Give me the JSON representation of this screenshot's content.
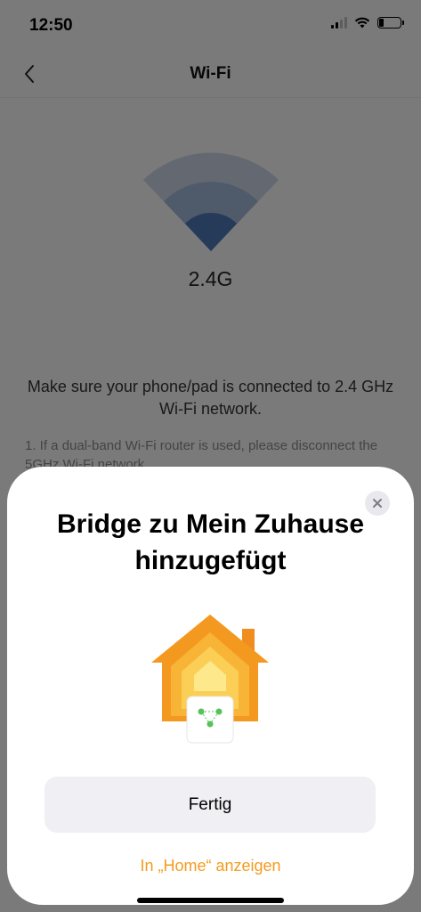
{
  "status_bar": {
    "time": "12:50",
    "battery_level": 0.2
  },
  "nav": {
    "title": "Wi-Fi",
    "back_icon": "chevron-left-icon"
  },
  "wifi": {
    "band": "2.4G",
    "instruction": "Make sure your phone/pad is connected to 2.4 GHz Wi-Fi network.",
    "hint": "1. If a dual-band Wi-Fi router is used, please disconnect the 5GHz Wi-Fi network."
  },
  "sheet": {
    "title": "Bridge zu Mein Zuhause hinzugefügt",
    "done_label": "Fertig",
    "home_link_label": "In „Home“ anzeigen",
    "close_icon": "close-icon",
    "accent_color": "#f39c1f"
  }
}
